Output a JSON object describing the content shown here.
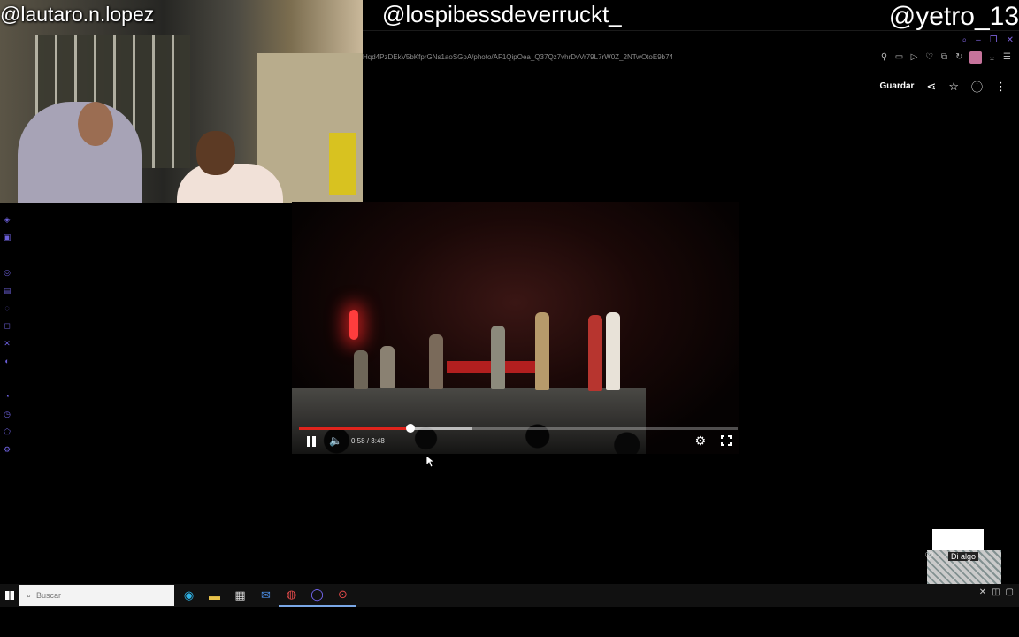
{
  "overlay": {
    "handle_left": "@lautaro.n.lopez",
    "handle_center": "@lospibessdeverruckt_",
    "handle_right": "@yetro_13"
  },
  "browser": {
    "url": "Hqd4PzDEkV5bKfprGNs1aoSGpA/photo/AF1QipOea_Q37Qz7vhrDvVr79L7rW0Z_2NTwOtoE9b74"
  },
  "photo_viewer": {
    "save_label": "Guardar"
  },
  "player": {
    "time_display": "0:58 / 3:48",
    "played_fraction": 0.254,
    "buffered_fraction": 0.395
  },
  "chat_widget": {
    "prompt": "Di algo"
  },
  "taskbar": {
    "search_placeholder": "Buscar"
  },
  "colors": {
    "accent": "#6b5fd9",
    "progress": "#e0241c"
  }
}
